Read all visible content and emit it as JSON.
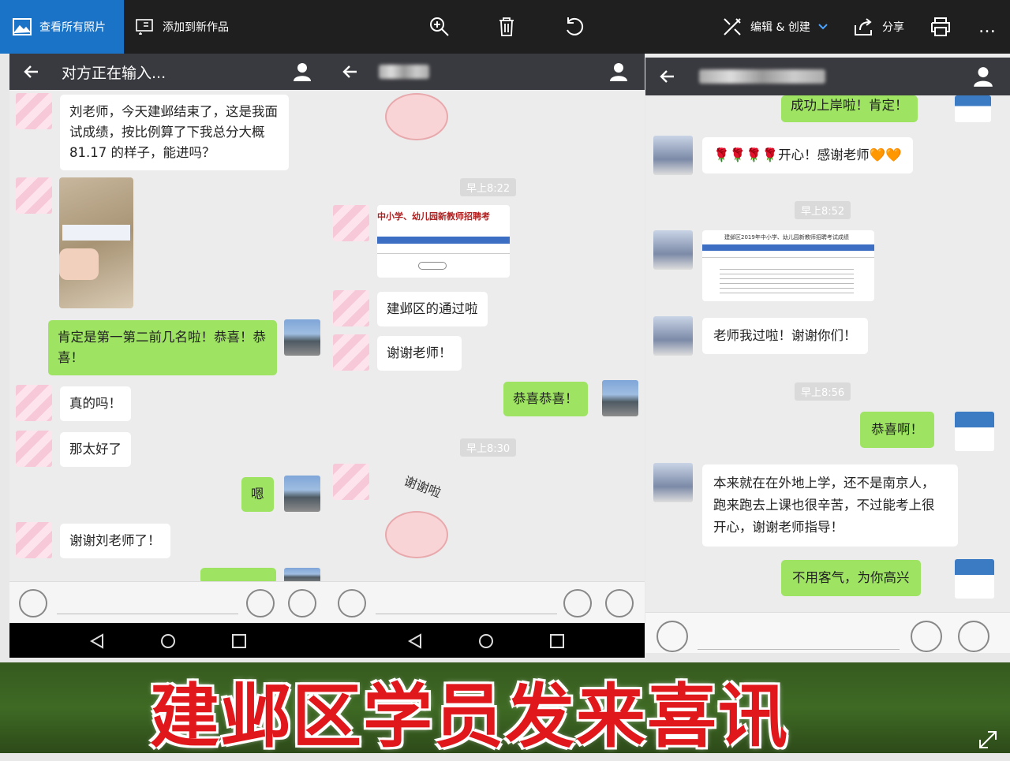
{
  "toolbar": {
    "view_all": "查看所有照片",
    "add_to": "添加到新作品",
    "edit_create": "编辑 & 创建",
    "share": "分享",
    "more": "…"
  },
  "panel1": {
    "title": "对方正在输入...",
    "msg1": "刘老师，今天建邺结束了，这是我面试成绩，按比例算了下我总分大概 81.17 的样子，能进吗？",
    "msg2": "肯定是第一第二前几名啦！恭喜！恭喜！",
    "msg3": "真的吗！",
    "msg4": "那太好了",
    "msg5": "嗯",
    "msg6": "谢谢刘老师了！"
  },
  "panel2": {
    "ts1": "早上8:22",
    "card_title": "中小学、幼儿园新教师招聘考",
    "msg1": "建邺区的通过啦",
    "msg2": "谢谢老师！",
    "msg3": "恭喜恭喜！",
    "ts2": "早上8:30",
    "sticker_text": "谢谢啦"
  },
  "panel3": {
    "msg0": "成功上岸啦！肯定！",
    "msg1": "🌹🌹🌹🌹开心！感谢老师🧡🧡",
    "ts1": "早上8:52",
    "card_title": "建邺区2019年中小学、幼儿园新教师招聘考试成绩",
    "msg2": "老师我过啦！谢谢你们！",
    "ts2": "早上8:56",
    "msg3": "恭喜啊！",
    "msg4": "本来就在在外地上学，还不是南京人，跑来跑去上课也很辛苦，不过能考上很开心，谢谢老师指导！",
    "msg5": "不用客气，为你高兴"
  },
  "banner": {
    "text": "建邺区学员发来喜讯"
  }
}
